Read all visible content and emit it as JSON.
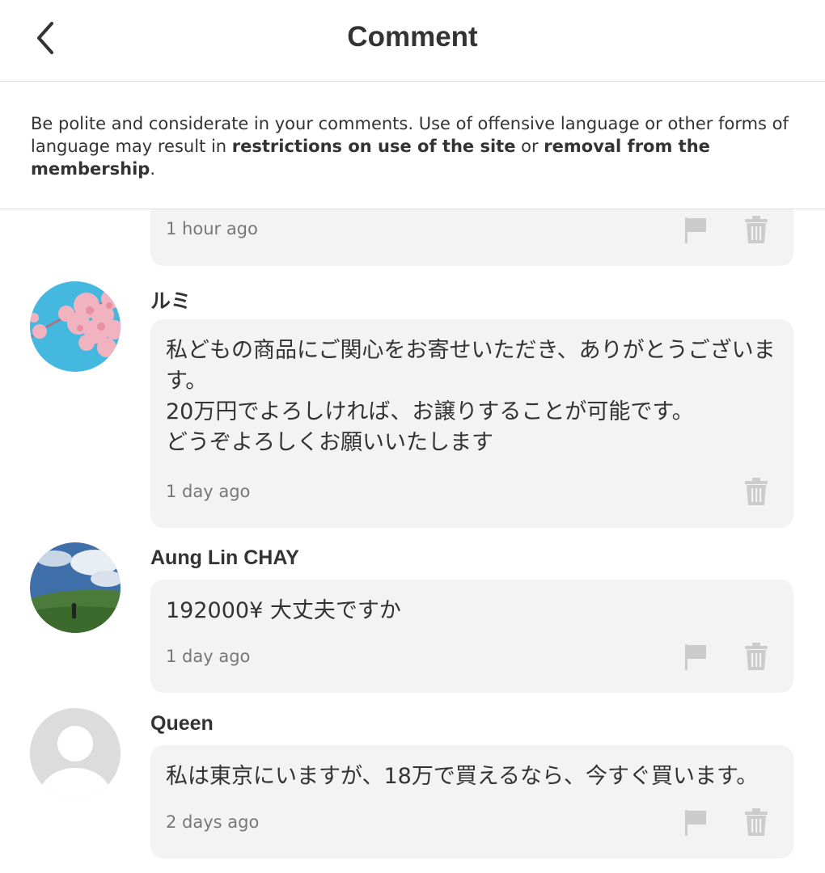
{
  "header": {
    "title": "Comment"
  },
  "notice": {
    "part1": "Be polite and considerate in your comments. Use of offensive language or other forms of language may result in ",
    "bold1": "restrictions on use of the site",
    "part2": " or ",
    "bold2": "removal from the membership",
    "part3": "."
  },
  "comments": [
    {
      "author": "",
      "text": "",
      "time": "1 hour ago",
      "icons": [
        "flag-icon",
        "trash-icon"
      ]
    },
    {
      "author": "ルミ",
      "avatar": "cherry-blossom-avatar",
      "text": "私どもの商品にご関心をお寄せいただき、ありがとうございます。\n20万円でよろしければ、お譲りすることが可能です。\nどうぞよろしくお願いいたします",
      "time": "1 day ago",
      "icons": [
        "trash-icon"
      ]
    },
    {
      "author": "Aung Lin CHAY",
      "avatar": "landscape-avatar",
      "text": "192000¥ 大丈夫ですか",
      "time": "1 day ago",
      "icons": [
        "flag-icon",
        "trash-icon"
      ]
    },
    {
      "author": "Queen",
      "avatar": "default-user-avatar",
      "text": "私は東京にいますが、18万で買えるなら、今すぐ買います。",
      "time": "2 days ago",
      "icons": [
        "flag-icon",
        "trash-icon"
      ]
    }
  ],
  "colors": {
    "bubble": "#f3f3f3",
    "icon": "#cccccc",
    "divider": "#dddddd",
    "text": "#333333",
    "muted": "#777777"
  }
}
